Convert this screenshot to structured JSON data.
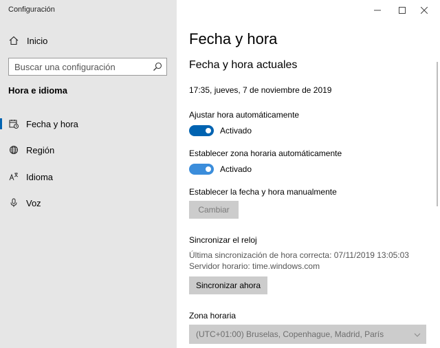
{
  "app_title": "Configuración",
  "colors": {
    "accent": "#0063b1",
    "toggle_secondary": "#3b8ddb",
    "sidebar_bg": "#e6e6e6"
  },
  "sidebar": {
    "home_label": "Inicio",
    "search_placeholder": "Buscar una configuración",
    "section_title": "Hora e idioma",
    "items": [
      {
        "label": "Fecha y hora",
        "icon": "calendar-clock-icon",
        "active": true
      },
      {
        "label": "Región",
        "icon": "globe-icon",
        "active": false
      },
      {
        "label": "Idioma",
        "icon": "language-icon",
        "active": false
      },
      {
        "label": "Voz",
        "icon": "microphone-icon",
        "active": false
      }
    ]
  },
  "window_controls": [
    "minimize-icon",
    "maximize-icon",
    "close-icon"
  ],
  "main": {
    "title": "Fecha y hora",
    "current_section": "Fecha y hora actuales",
    "current_datetime": "17:35, jueves, 7 de noviembre de 2019",
    "auto_time": {
      "label": "Ajustar hora automáticamente",
      "state": "Activado"
    },
    "auto_timezone": {
      "label": "Establecer zona horaria automáticamente",
      "state": "Activado"
    },
    "manual": {
      "label": "Establecer la fecha y hora manualmente",
      "button": "Cambiar"
    },
    "sync": {
      "title": "Sincronizar el reloj",
      "last_sync": "Última sincronización de hora correcta: 07/11/2019 13:05:03",
      "server": "Servidor horario: time.windows.com",
      "button": "Sincronizar ahora"
    },
    "timezone": {
      "label": "Zona horaria",
      "value": "(UTC+01:00) Bruselas, Copenhague, Madrid, París"
    }
  }
}
